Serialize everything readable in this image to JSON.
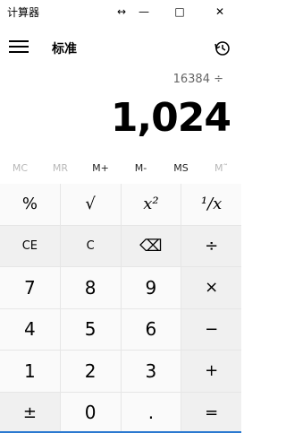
{
  "window": {
    "title": "计算器",
    "icons": [
      "resize-icon",
      "minimize-icon",
      "maximize-icon",
      "close-icon"
    ],
    "minimize_glyph": "—",
    "maximize_glyph": "□",
    "close_glyph": "✕",
    "drag_glyph": "↔"
  },
  "header": {
    "mode_title": "标准",
    "menu_icon": "hamburger-menu-icon",
    "history_icon": "history-icon"
  },
  "display": {
    "expression": "16384 ÷",
    "result": "1,024"
  },
  "memory": [
    "MC",
    "MR",
    "M+",
    "M-",
    "MS",
    "M˜"
  ],
  "keys": {
    "r1": [
      "%",
      "√",
      "x²",
      "¹/x"
    ],
    "r2": [
      "CE",
      "C",
      "⌫",
      "÷"
    ],
    "r3": [
      "7",
      "8",
      "9",
      "×"
    ],
    "r4": [
      "4",
      "5",
      "6",
      "−"
    ],
    "r5": [
      "1",
      "2",
      "3",
      "+"
    ],
    "r6": [
      "±",
      "0",
      ".",
      "="
    ]
  },
  "colors": {
    "accent": "#2b79d0",
    "key_bg": "#f0f0f0",
    "number_key_bg": "#fafafa"
  }
}
